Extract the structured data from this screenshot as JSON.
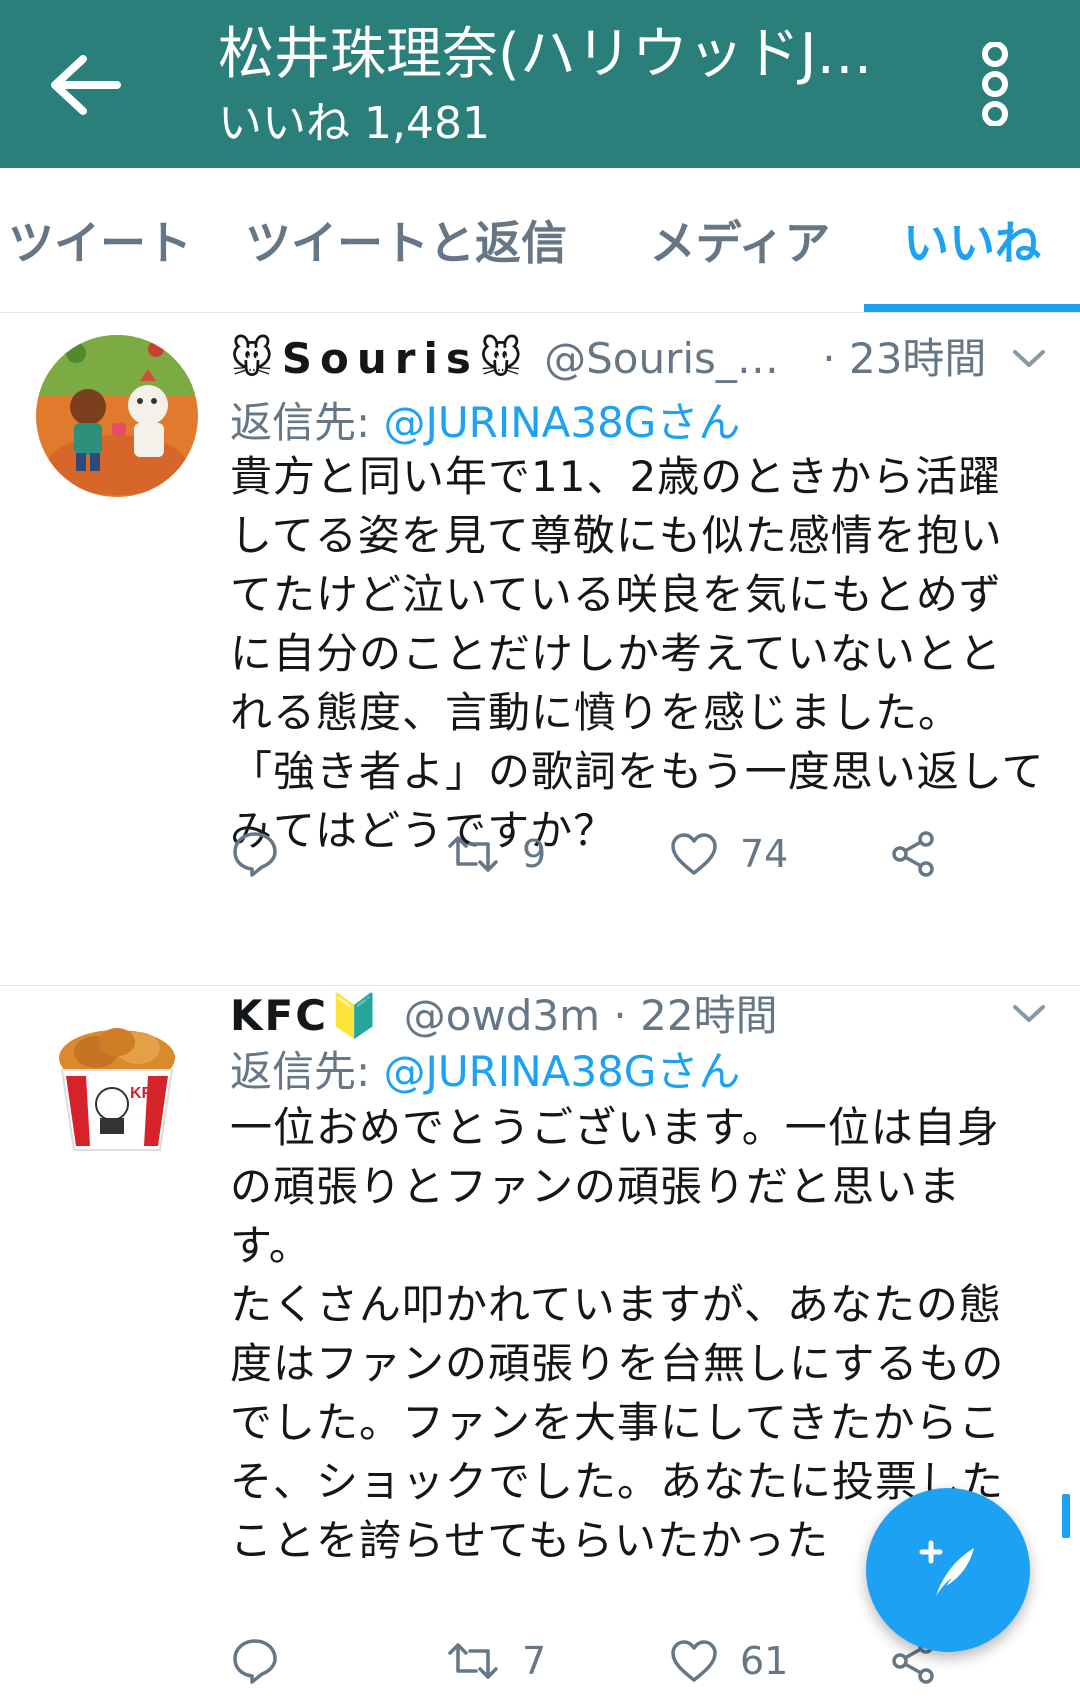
{
  "header": {
    "title": "松井珠理奈(ハリウッドJ…",
    "subtitle_label": "いいね",
    "subtitle_count": "1,481",
    "back_icon": "arrow-left-icon",
    "more_icon": "more-vertical-icon",
    "bar_color": "#2a7f7a"
  },
  "tabs": [
    {
      "label": "ツイート",
      "active": false
    },
    {
      "label": "ツイートと返信",
      "active": false
    },
    {
      "label": "メディア",
      "active": false
    },
    {
      "label": "いいね",
      "active": true
    }
  ],
  "accent_color": "#1da1f2",
  "tweets": [
    {
      "display_name": "🐭Souris🐭",
      "handle": "@Souris_…",
      "dot": "·",
      "time": "23時間",
      "reply_label": "返信先:",
      "reply_mention": "@JURINA38Gさん",
      "text": "貴方と同い年で11、2歳のときから活躍\nしてる姿を見て尊敬にも似た感情を抱い\nてたけど泣いている咲良を気にもとめず\nに自分のことだけしか考えていないとと\nれる態度、言動に憤りを感じました。\n「強き者よ」の歌詞をもう一度思い返して\nみてはどうですか？",
      "actions": {
        "retweets": "9",
        "likes": "74"
      }
    },
    {
      "display_name": "KFC🔰",
      "handle": "@owd3m",
      "dot": "·",
      "time": "22時間",
      "reply_label": "返信先:",
      "reply_mention": "@JURINA38Gさん",
      "text": "一位おめでとうございます。一位は自身\nの頑張りとファンの頑張りだと思いま\nす。\nたくさん叩かれていますが、あなたの態\n度はファンの頑張りを台無しにするもの\nでした。ファンを大事にしてきたからこ\nそ、ショックでした。あなたに投票した\nことを誇らせてもらいたかった",
      "actions": {
        "retweets": "7",
        "likes": "61"
      }
    }
  ],
  "fab": {
    "icon": "compose-tweet-icon"
  }
}
